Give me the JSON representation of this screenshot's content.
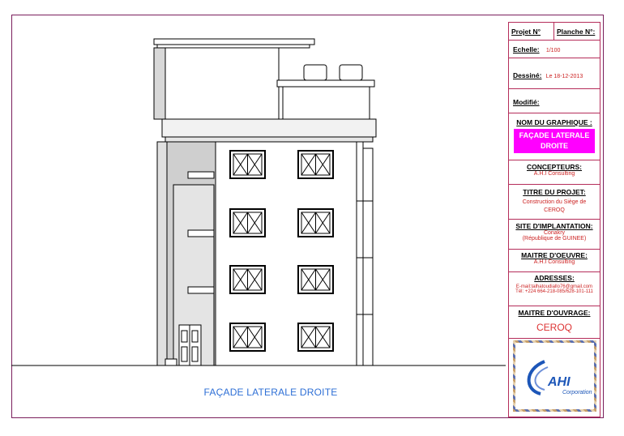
{
  "drawing": {
    "caption": "FAÇADE LATERALE DROITE"
  },
  "title_block": {
    "projet_label": "Projet N°",
    "planche_label": "Planche N°:",
    "echelle_label": "Echelle:",
    "echelle_value": "1/100",
    "dessine_label": "Dessiné:",
    "dessine_value": "Le 18-12-2013",
    "modifie_label": "Modifié:",
    "nom_label": "NOM DU GRAPHIQUE :",
    "nom_value": "FAÇADE LATERALE DROITE",
    "concepteurs_label": "CONCEPTEURS:",
    "concepteurs_value": "A.H.I Consulting",
    "titre_label": "TITRE DU PROJET:",
    "titre_value": "Construction du Siège de CEROQ",
    "site_label": "SITE D'IMPLANTATION:",
    "site_value_1": "Conakry",
    "site_value_2": "(République de GUINEE)",
    "maitre_oeuvre_label": "MAITRE D'OEUVRE:",
    "maitre_oeuvre_value": "A.H.I Consulting",
    "adresses_label": "ADRESSES:",
    "adresses_email": "E-mail:talhatoudiallo76@gmail.com",
    "adresses_tel": "Tél: +224 664-218-085/628-101-111",
    "maitre_ouvrage_label": "MAITRE D'OUVRAGE:",
    "maitre_ouvrage_value": "CEROQ",
    "logo_text": "AHI",
    "logo_sub": "Corporation"
  },
  "colors": {
    "border": "#7a1f5c",
    "title_block_border": "#b52d5a",
    "highlight": "#ff00ff",
    "caption": "#2e6fd6",
    "value_text": "#cc2222"
  }
}
